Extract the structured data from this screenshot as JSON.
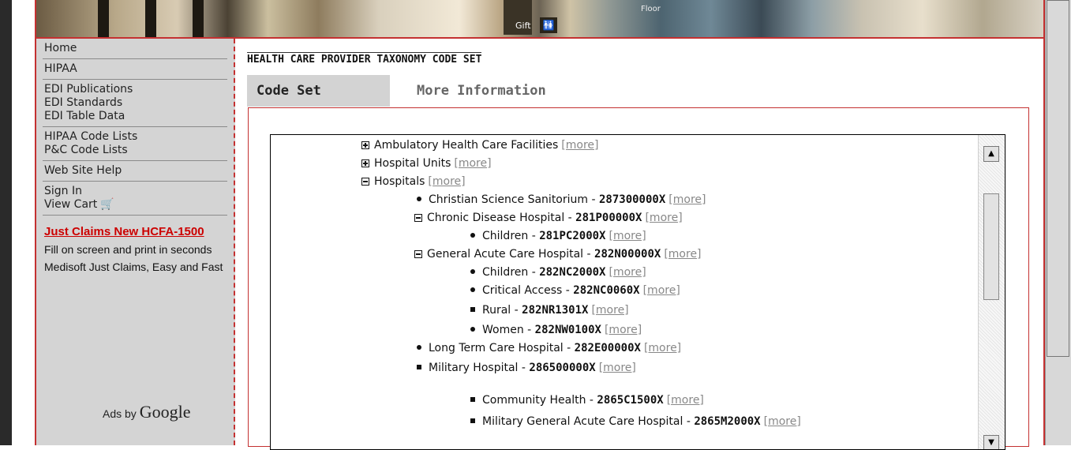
{
  "sidebar": {
    "groups": [
      [
        "Home"
      ],
      [
        "HIPAA"
      ],
      [
        "EDI Publications",
        "EDI Standards",
        "EDI Table Data"
      ],
      [
        "HIPAA Code Lists",
        "P&C Code Lists"
      ],
      [
        "Web Site Help"
      ],
      [
        "Sign In",
        "View Cart"
      ]
    ],
    "ad": {
      "title": "Just Claims New HCFA-1500",
      "text": "Fill on screen and print in seconds Medisoft Just Claims, Easy and Fast"
    },
    "ads_by_prefix": "Ads by",
    "ads_by_brand": "Google"
  },
  "banner": {
    "gift_label": "Gift",
    "floor_label": "Floor"
  },
  "page_title": "HEALTH CARE PROVIDER TAXONOMY CODE SET",
  "tabs": {
    "active": "Code Set",
    "inactive": "More Information"
  },
  "tree": {
    "more_label": "[more]",
    "rows": [
      {
        "label": "Ambulatory Health Care Facilities",
        "code": "",
        "icon": "plus"
      },
      {
        "label": "Hospital Units",
        "code": "",
        "icon": "plus"
      },
      {
        "label": "Hospitals",
        "code": "",
        "icon": "minus"
      },
      {
        "label": "Christian Science Sanitorium - ",
        "code": "287300000X",
        "icon": "bullet"
      },
      {
        "label": "Chronic Disease Hospital - ",
        "code": "281P00000X",
        "icon": "minus"
      },
      {
        "label": "Children - ",
        "code": "281PC2000X",
        "icon": "bullet"
      },
      {
        "label": "General Acute Care Hospital - ",
        "code": "282N00000X",
        "icon": "minus"
      },
      {
        "label": "Children - ",
        "code": "282NC2000X",
        "icon": "bullet"
      },
      {
        "label": "Critical Access  - ",
        "code": "282NC0060X",
        "icon": "bullet"
      },
      {
        "label": "Rural - ",
        "code": "282NR1301X",
        "icon": "square"
      },
      {
        "label": "Women - ",
        "code": "282NW0100X",
        "icon": "bullet"
      },
      {
        "label": "Long Term Care Hospital - ",
        "code": "282E00000X",
        "icon": "bullet"
      },
      {
        "label": "Military Hospital - ",
        "code": "286500000X",
        "icon": "square"
      },
      {
        "label": "Community Health - ",
        "code": "2865C1500X",
        "icon": "square"
      },
      {
        "label": "Military General Acute Care Hospital - ",
        "code": "2865M2000X",
        "icon": "square"
      }
    ]
  }
}
